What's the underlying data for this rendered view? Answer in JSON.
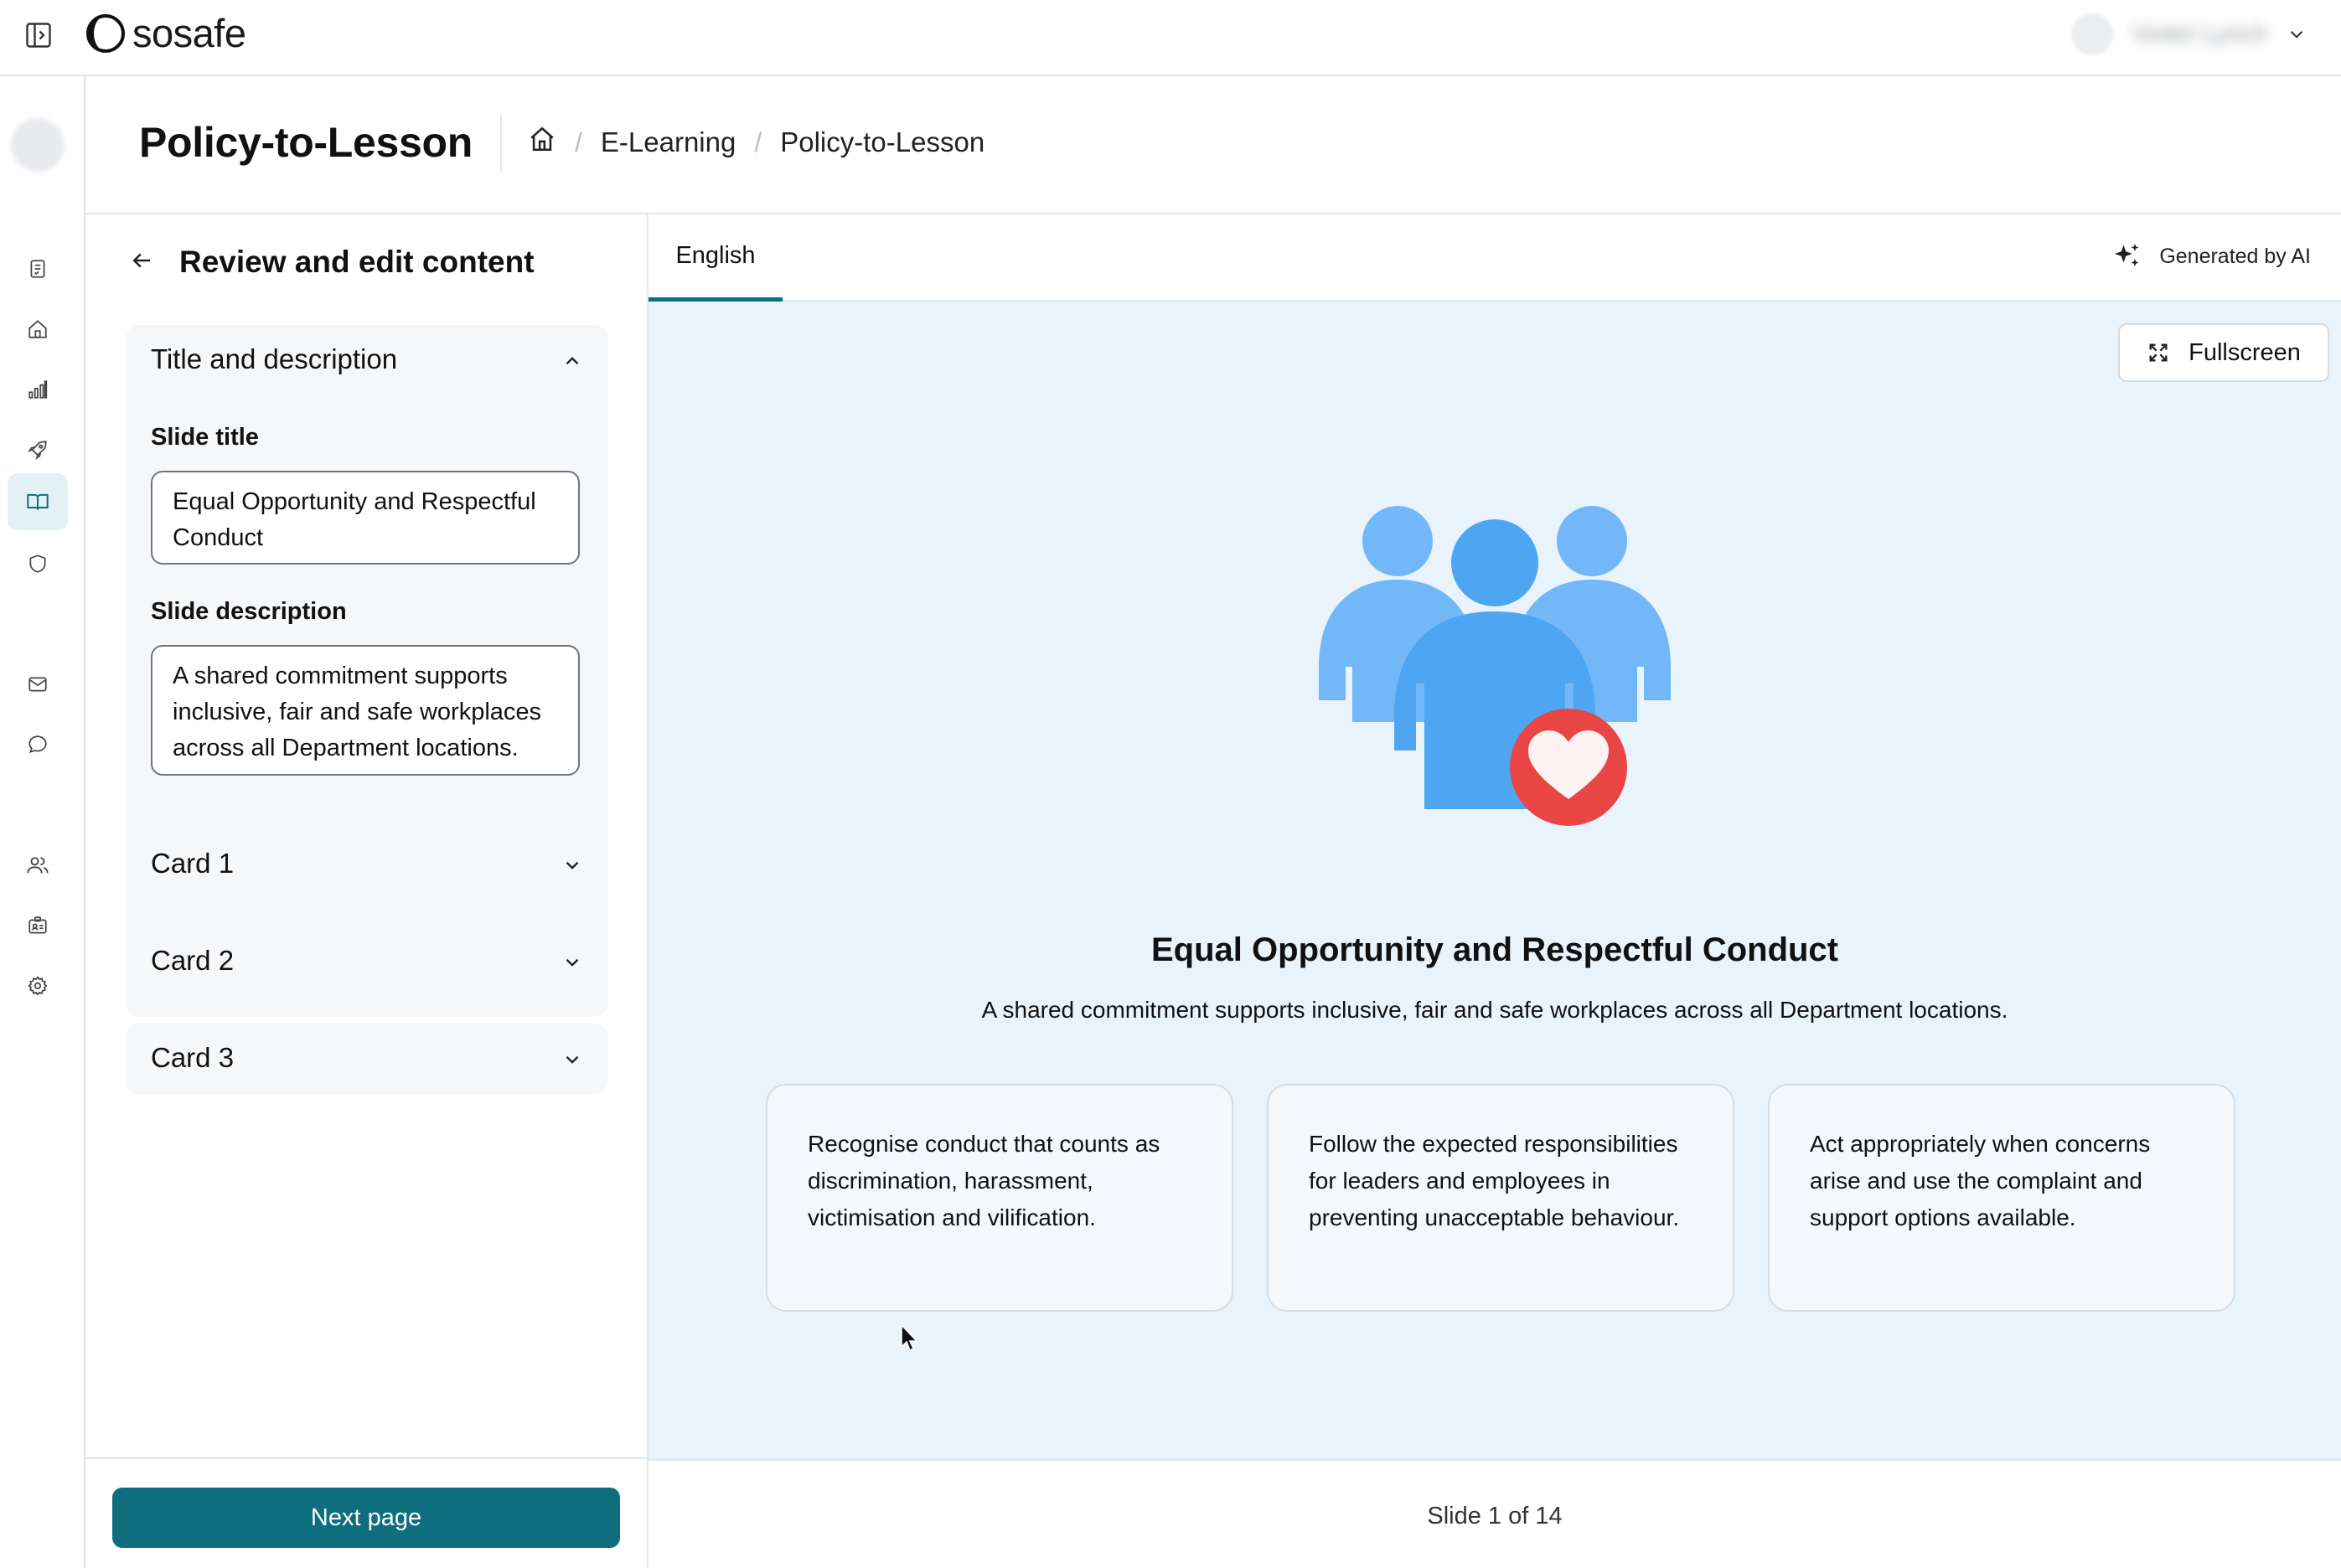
{
  "app": {
    "brand": "sosafe",
    "user_name": "Violet Lynch"
  },
  "header": {
    "title": "Policy-to-Lesson",
    "breadcrumb": [
      "E-Learning",
      "Policy-to-Lesson"
    ]
  },
  "editor": {
    "heading": "Review and edit content",
    "section_open": {
      "label": "Title and description",
      "slide_title_label": "Slide title",
      "slide_title_value": "Equal Opportunity and Respectful Conduct",
      "slide_description_label": "Slide description",
      "slide_description_value": "A shared commitment supports inclusive, fair and safe workplaces across all Department locations."
    },
    "sections_collapsed": [
      "Card 1",
      "Card 2",
      "Card 3"
    ],
    "next_button": "Next page"
  },
  "preview": {
    "language_tab": "English",
    "ai_label": "Generated by AI",
    "fullscreen_label": "Fullscreen",
    "slide_title": "Equal Opportunity and Respectful Conduct",
    "slide_description": "A shared commitment supports inclusive, fair and safe workplaces across all Department locations.",
    "cards": [
      "Recognise conduct that counts as discrimination, harassment, victimisation and vilification.",
      "Follow the expected responsibilities for leaders and employees in preventing unacceptable behaviour.",
      "Act appropriately when concerns arise and use the complaint and support options available."
    ],
    "slide_counter": "Slide 1 of 14"
  },
  "colors": {
    "accent": "#0f6e7e",
    "stage_bg": "#e8f3fb",
    "people_light": "#72b8f8",
    "people_main": "#4ea6f2",
    "heart_bg": "#e94545"
  },
  "icons": {
    "sidebar": [
      "checklist-icon",
      "home-icon",
      "analytics-icon",
      "rocket-icon",
      "book-icon",
      "shield-icon",
      "mail-icon",
      "chat-icon",
      "users-icon",
      "badge-icon",
      "gear-icon"
    ]
  }
}
